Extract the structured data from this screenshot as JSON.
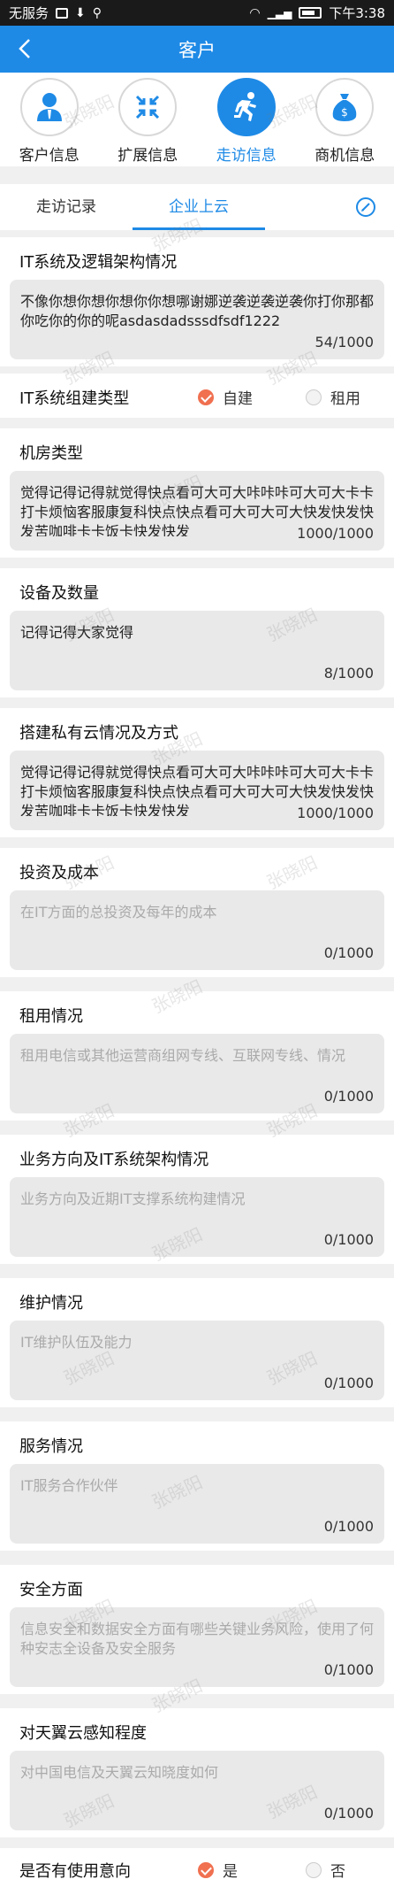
{
  "status_bar": {
    "carrier": "无服务",
    "time": "下午3:38"
  },
  "header": {
    "title": "客户"
  },
  "modules": [
    {
      "label": "客户信息",
      "icon": "person-icon"
    },
    {
      "label": "扩展信息",
      "icon": "expand-arrows-icon"
    },
    {
      "label": "走访信息",
      "icon": "running-person-icon"
    },
    {
      "label": "商机信息",
      "icon": "money-bag-icon"
    }
  ],
  "sub_tabs": {
    "visit_record": "走访记录",
    "cloud": "企业上云"
  },
  "fields": [
    {
      "title": "IT系统及逻辑架构情况",
      "text": "不像你想你想你想你你想哪谢娜逆袭逆袭逆袭你打你那都你吃你的你的呢asdasdadsssdfsdf1222",
      "placeholder": "",
      "count": "54/1000"
    },
    {
      "title": "机房类型",
      "text": "觉得记得记得就觉得快点看可大可大咔咔咔可大可大卡卡打卡烦恼客服康复科快点快点看可大可大可大快发快发快发苦咖啡卡卡饭卡快发快发",
      "placeholder": "",
      "count": "1000/1000"
    },
    {
      "title": "设备及数量",
      "text": "记得记得大家觉得",
      "placeholder": "",
      "count": "8/1000"
    },
    {
      "title": "搭建私有云情况及方式",
      "text": "觉得记得记得就觉得快点看可大可大咔咔咔可大可大卡卡打卡烦恼客服康复科快点快点看可大可大可大快发快发快发苦咖啡卡卡饭卡快发快发",
      "placeholder": "",
      "count": "1000/1000"
    },
    {
      "title": "投资及成本",
      "text": "",
      "placeholder": "在IT方面的总投资及每年的成本",
      "count": "0/1000"
    },
    {
      "title": "租用情况",
      "text": "",
      "placeholder": "租用电信或其他运营商组网专线、互联网专线、情况",
      "count": "0/1000"
    },
    {
      "title": "业务方向及IT系统架构情况",
      "text": "",
      "placeholder": "业务方向及近期IT支撑系统构建情况",
      "count": "0/1000"
    },
    {
      "title": "维护情况",
      "text": "",
      "placeholder": "IT维护队伍及能力",
      "count": "0/1000"
    },
    {
      "title": "服务情况",
      "text": "",
      "placeholder": "IT服务合作伙伴",
      "count": "0/1000"
    },
    {
      "title": "安全方面",
      "text": "",
      "placeholder": "信息安全和数据安全方面有哪些关键业务风险，使用了何种安志全设备及安全服务",
      "count": "0/1000"
    },
    {
      "title": "对天翼云感知程度",
      "text": "",
      "placeholder": "对中国电信及天翼云知晓度如何",
      "count": "0/1000"
    }
  ],
  "radio_it_system": {
    "title": "IT系统组建类型",
    "option_a": "自建",
    "option_b": "租用",
    "selected": "自建"
  },
  "radio_intent": {
    "title": "是否有使用意向",
    "option_a": "是",
    "option_b": "否",
    "selected": "是"
  },
  "watermark_text": "张晓阳",
  "colors": {
    "brand_blue": "#1e8ae6",
    "radio_checked": "#f07050",
    "box_gray": "#e9e9e9"
  }
}
